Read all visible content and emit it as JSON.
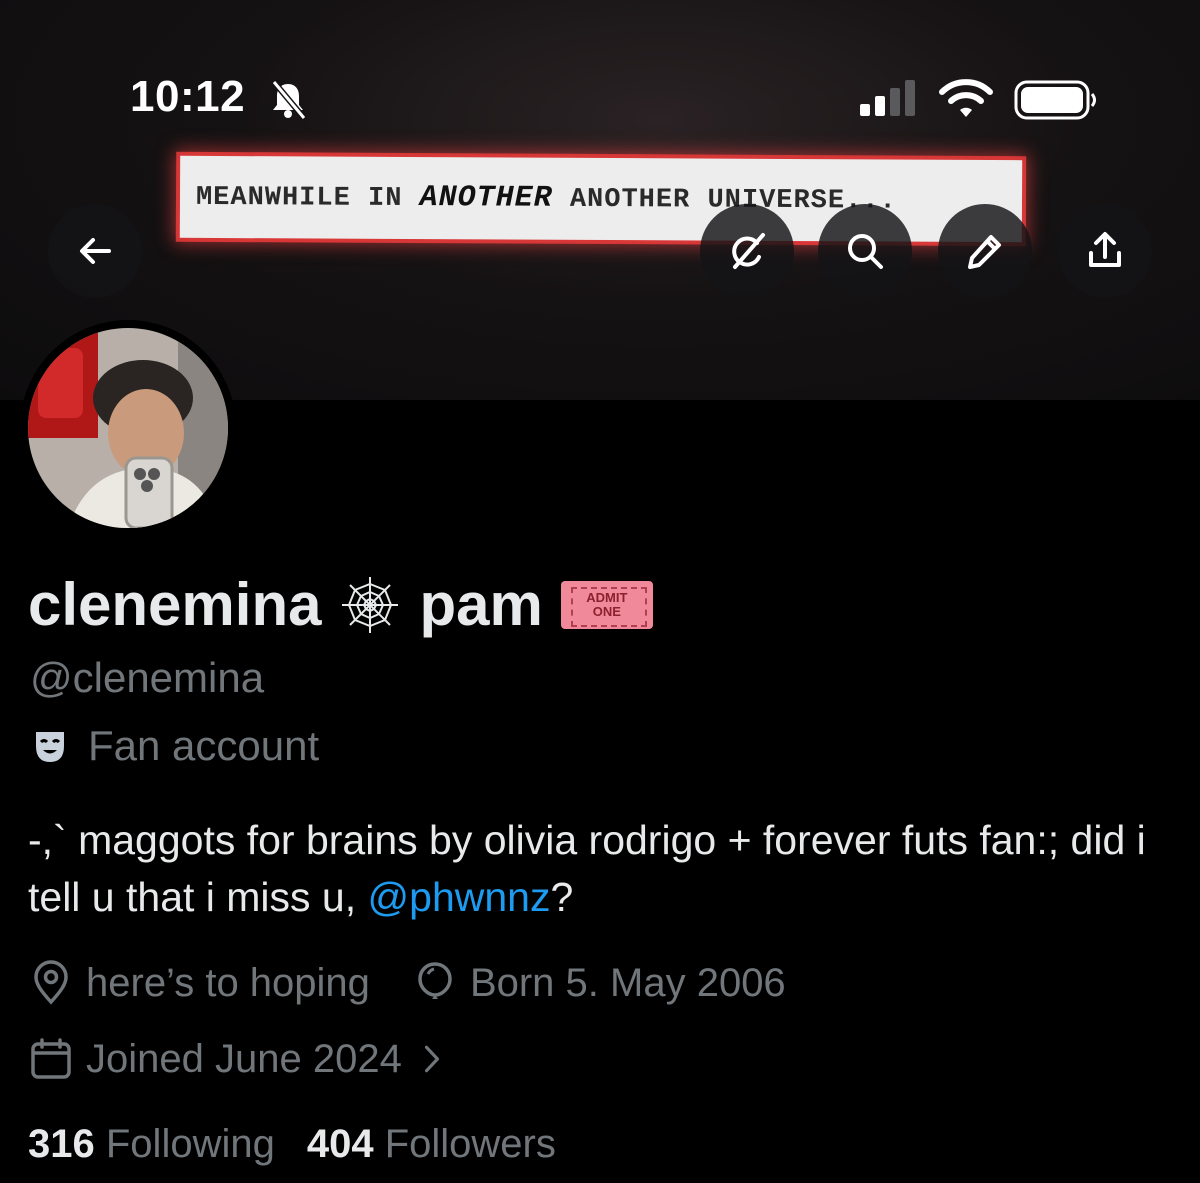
{
  "status_bar": {
    "time": "10:12"
  },
  "banner": {
    "caption_prefix": "MEANWHILE IN ",
    "caption_emphasis": "ANOTHER",
    "caption_suffix": " ANOTHER UNIVERSE..."
  },
  "header_buttons": {
    "back_icon": "arrow-left-icon",
    "actions": [
      "grok-icon",
      "search-icon",
      "edit-icon",
      "share-icon"
    ]
  },
  "profile": {
    "display_name_first": "clenemina",
    "display_name_second": "pam",
    "web_emoji": "🕸",
    "ticket_line1": "ADMIT",
    "ticket_line2": "ONE",
    "handle": "@clenemina",
    "category_label": "Fan account",
    "bio_text": "-,` maggots for brains by olivia rodrigo + forever futs fan:; did i tell u that i miss u, ",
    "bio_mention": "@phwnnz",
    "bio_end": "?",
    "location": "here’s to hoping",
    "birthday": "Born 5. May 2006",
    "joined": "Joined June 2024",
    "following_count": "316",
    "following_label": "Following",
    "followers_count": "404",
    "followers_label": "Followers"
  },
  "colors": {
    "background": "#000000",
    "primary_text": "#e7e9ea",
    "secondary_text": "#71767b",
    "link": "#1d9bf0",
    "banner_glow": "#ff4646"
  }
}
